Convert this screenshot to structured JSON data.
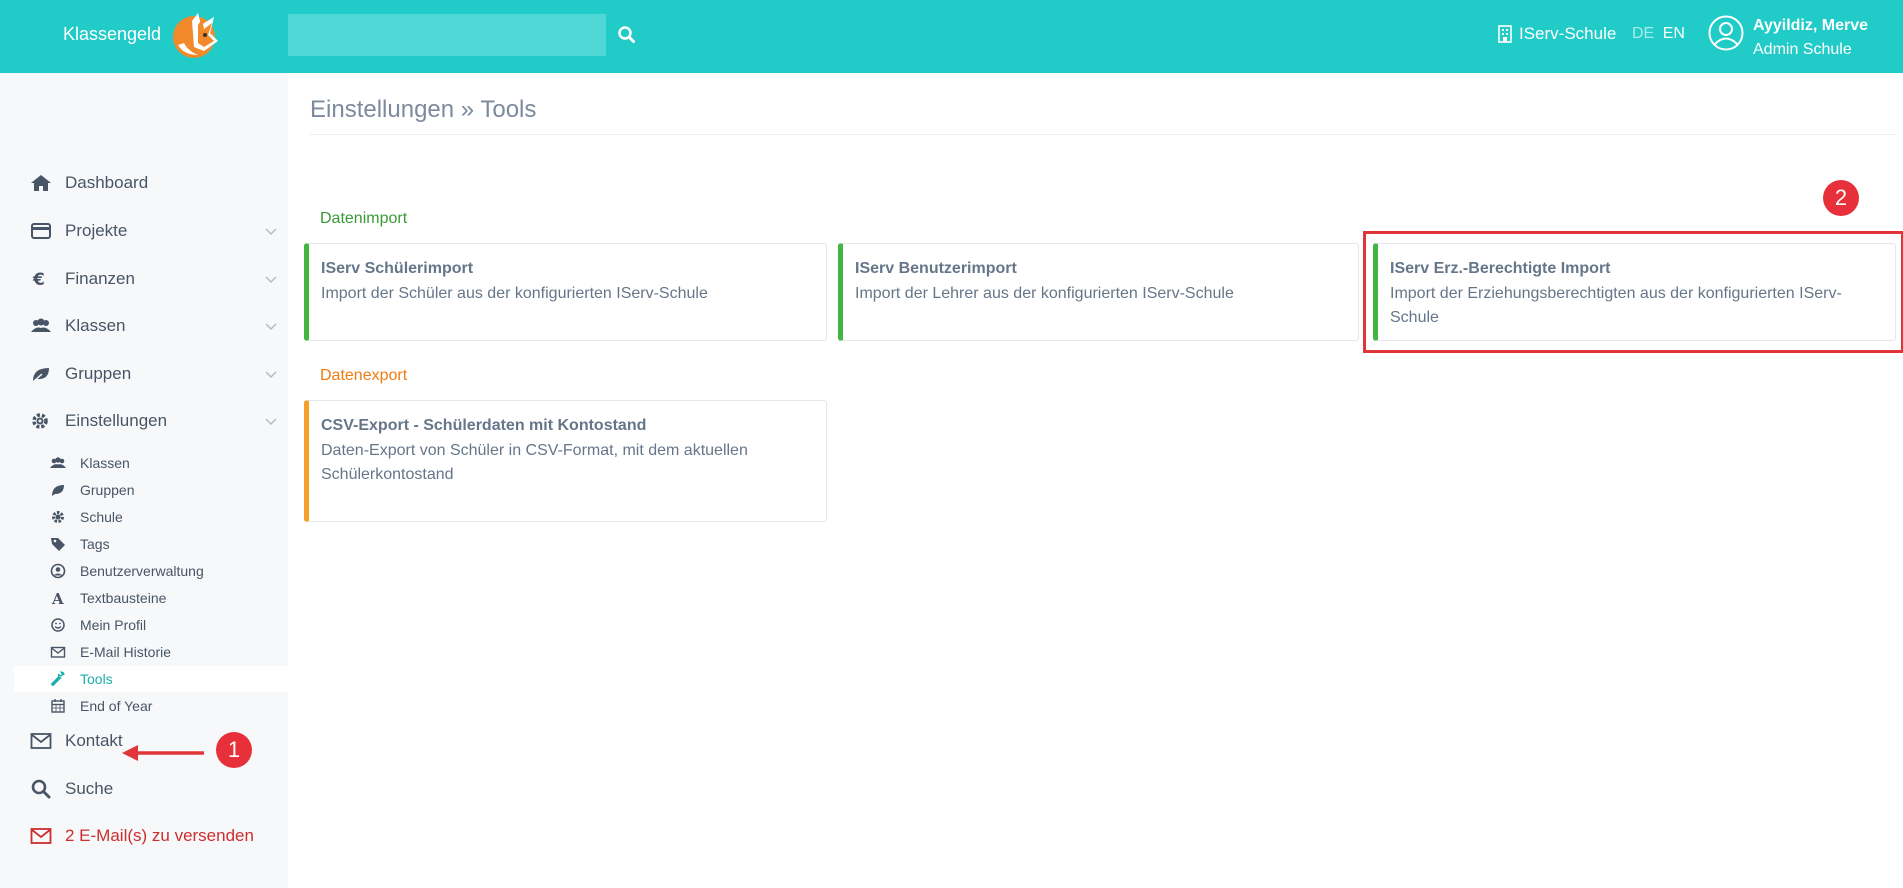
{
  "header": {
    "brand": "Klassengeld",
    "search_placeholder": "",
    "school": "IServ-Schule",
    "lang_de": "DE",
    "lang_en": "EN",
    "user_name": "Ayyildiz, Merve",
    "user_role": "Admin Schule"
  },
  "sidebar": {
    "items": [
      {
        "label": "Dashboard",
        "icon": "home-icon"
      },
      {
        "label": "Projekte",
        "icon": "credit-card-icon"
      },
      {
        "label": "Finanzen",
        "icon": "euro-icon"
      },
      {
        "label": "Klassen",
        "icon": "users-icon"
      },
      {
        "label": "Gruppen",
        "icon": "leaf-icon"
      },
      {
        "label": "Einstellungen",
        "icon": "gear-icon"
      }
    ],
    "settings_sub": [
      {
        "label": "Klassen",
        "icon": "users-icon"
      },
      {
        "label": "Gruppen",
        "icon": "leaf-icon"
      },
      {
        "label": "Schule",
        "icon": "gear-icon"
      },
      {
        "label": "Tags",
        "icon": "tag-icon"
      },
      {
        "label": "Benutzerverwaltung",
        "icon": "user-circle-icon"
      },
      {
        "label": "Textbausteine",
        "icon": "font-icon"
      },
      {
        "label": "Mein Profil",
        "icon": "smile-icon"
      },
      {
        "label": "E-Mail Historie",
        "icon": "envelope-icon"
      },
      {
        "label": "Tools",
        "icon": "wrench-icon",
        "active": true
      },
      {
        "label": "End of Year",
        "icon": "calendar-icon"
      }
    ],
    "bottom": [
      {
        "label": "Kontakt",
        "icon": "envelope-icon"
      },
      {
        "label": "Suche",
        "icon": "search-icon"
      },
      {
        "label": "2 E-Mail(s) zu versenden",
        "icon": "envelope-icon",
        "color": "#cc2e2e"
      }
    ]
  },
  "main": {
    "breadcrumb": "Einstellungen » Tools",
    "import": {
      "title": "Datenimport",
      "color": "#3a9a36",
      "cards": [
        {
          "title": "IServ Schülerimport",
          "desc": "Import der Schüler aus der konfigurierten IServ-Schule"
        },
        {
          "title": "IServ Benutzerimport",
          "desc": "Import der Lehrer aus der konfigurierten IServ-Schule"
        },
        {
          "title": "IServ Erz.-Berechtigte Import",
          "desc": "Import der Erziehungsberechtigten aus der konfigurierten IServ-Schule"
        }
      ]
    },
    "export": {
      "title": "Datenexport",
      "color": "#f07b12",
      "cards": [
        {
          "title": "CSV-Export - Schülerdaten mit Kontostand",
          "desc": "Daten-Export von Schüler in CSV-Format, mit dem aktuellen Schülerkontostand"
        }
      ]
    }
  },
  "annotations": {
    "step1": "1",
    "step2": "2",
    "color": "#e8303a"
  },
  "colors": {
    "topbar": "#20cbc8",
    "active_link": "#1aaea9"
  }
}
